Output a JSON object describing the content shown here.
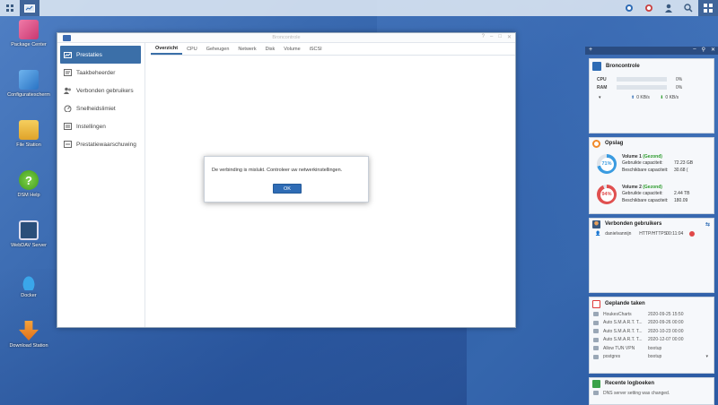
{
  "colors": {
    "accent": "#3b6fa8",
    "button": "#2f6cb5",
    "healthy": "#2a9a2a"
  },
  "taskbar": {
    "left_icons": [
      "grid-icon",
      "window-icon"
    ],
    "right_icons": [
      "sync-icon",
      "notification-icon",
      "user-icon",
      "search-icon",
      "widgets-icon"
    ]
  },
  "desktop": {
    "icons": [
      {
        "label": "Package Center",
        "icon": "package-center-icon",
        "color": "#d44a7a"
      },
      {
        "label": "Configuratiescherm",
        "icon": "control-panel-icon",
        "color": "#3a8ad2"
      },
      {
        "label": "File Station",
        "icon": "file-station-icon",
        "color": "#e8b23a"
      },
      {
        "label": "DSM Help",
        "icon": "help-icon",
        "color": "#5cb82e"
      },
      {
        "label": "WebDAV Server",
        "icon": "webdav-icon",
        "color": "#2b4f7a"
      },
      {
        "label": "Docker",
        "icon": "docker-icon",
        "color": "#1c8fd6"
      },
      {
        "label": "Download Station",
        "icon": "download-station-icon",
        "color": "#f28a1c"
      }
    ]
  },
  "window": {
    "title": "Broncontrole",
    "sidebar": [
      {
        "label": "Prestaties",
        "icon": "chart-icon",
        "active": true
      },
      {
        "label": "Taakbeheerder",
        "icon": "task-icon"
      },
      {
        "label": "Verbonden gebruikers",
        "icon": "users-icon"
      },
      {
        "label": "Snelheidslimiet",
        "icon": "speed-icon"
      },
      {
        "label": "Instellingen",
        "icon": "settings-icon"
      },
      {
        "label": "Prestatiewaarschuwing",
        "icon": "warning-icon"
      }
    ],
    "tabs": [
      "Overzicht",
      "CPU",
      "Geheugen",
      "Netwerk",
      "Disk",
      "Volume",
      "iSCSI"
    ],
    "active_tab": "Overzicht"
  },
  "dialog": {
    "message": "De verbinding is mislukt. Controleer uw netwerkinstellingen.",
    "ok": "OK"
  },
  "widgets": {
    "resource": {
      "title": "Broncontrole",
      "cpu_label": "CPU",
      "cpu_pct": "0%",
      "cpu_value": 0,
      "ram_label": "RAM",
      "ram_pct": "0%",
      "ram_value": 0,
      "up": "0 KB/s",
      "down": "0 KB/s"
    },
    "storage": {
      "title": "Opslag",
      "volumes": [
        {
          "name": "Volume 1",
          "status": "(Gezond)",
          "percent": "71%",
          "value": 71,
          "used_label": "Gebruikte capaciteit:",
          "used": "72.23 GB",
          "avail_label": "Beschikbare capaciteit:",
          "avail": "30.68 (",
          "color": "#3a9be0"
        },
        {
          "name": "Volume 2",
          "status": "(Gezond)",
          "percent": "94%",
          "value": 94,
          "used_label": "Gebruikte capaciteit:",
          "used": "2.44 TB",
          "avail_label": "Beschikbare capaciteit:",
          "avail": "180.09",
          "color": "#e05050"
        }
      ]
    },
    "users": {
      "title": "Verbonden gebruikers",
      "rows": [
        {
          "user": "danielvannijn",
          "proto": "HTTP/HTTPS",
          "time": "00:11:04"
        }
      ]
    },
    "tasks": {
      "title": "Geplande taken",
      "rows": [
        {
          "name": "HoukesCharts",
          "time": "2020-09-25 15:50"
        },
        {
          "name": "Auto S.M.A.R.T. T...",
          "time": "2020-09-26 00:00"
        },
        {
          "name": "Auto S.M.A.R.T. T...",
          "time": "2020-10-23 00:00"
        },
        {
          "name": "Auto S.M.A.R.T. T...",
          "time": "2020-12-07 00:00"
        },
        {
          "name": "Allow TUN VPN",
          "time": "bootup"
        },
        {
          "name": "postgres",
          "time": "bootup"
        }
      ]
    },
    "logs": {
      "title": "Recente logboeken",
      "rows": [
        "DNS server setting was changed."
      ]
    }
  }
}
